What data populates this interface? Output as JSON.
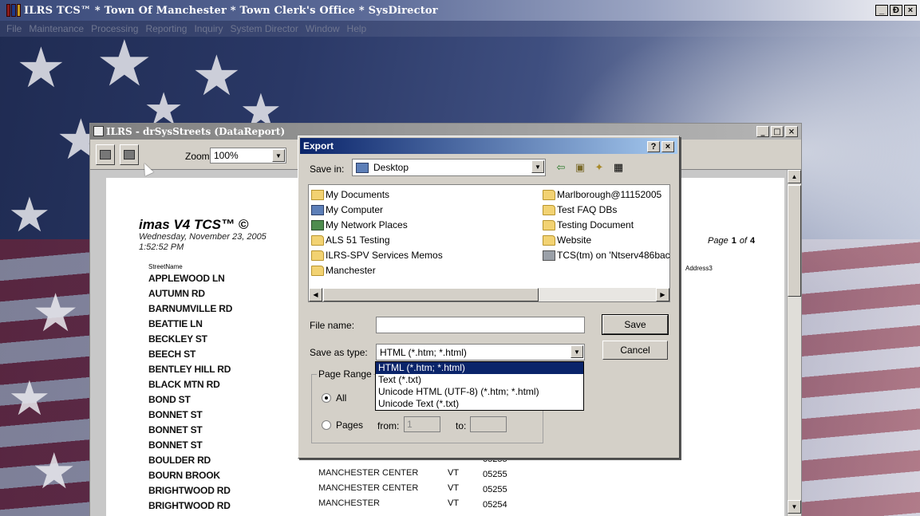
{
  "app": {
    "title": "ILRS TCS™ * Town Of Manchester * Town Clerk's Office * SysDirector",
    "controls": [
      "_",
      "Ɖ",
      "×"
    ],
    "menu": [
      "File",
      "Maintenance",
      "Processing",
      "Reporting",
      "Inquiry",
      "System Director",
      "Window",
      "Help"
    ]
  },
  "report_window": {
    "title": "ILRS - drSysStreets (DataReport)",
    "zoom_label": "Zoom",
    "zoom_value": "100%",
    "report_title": "imas V4 TCS™ ©",
    "report_date": "Wednesday, November 23, 2005",
    "report_time": "1:52:52 PM",
    "page_label": "Page",
    "page_current": "1",
    "page_of": "of",
    "page_total": "4",
    "col_street": "StreetName",
    "col_addr3": "Address3",
    "streets": [
      "APPLEWOOD LN",
      "AUTUMN RD",
      "BARNUMVILLE RD",
      "BEATTIE LN",
      "BECKLEY ST",
      "BEECH ST",
      "BENTLEY HILL RD",
      "BLACK MTN RD",
      "BOND ST",
      "BONNET ST",
      "BONNET ST",
      "BONNET ST",
      "BOULDER RD",
      "BOURN BROOK",
      "BRIGHTWOOD RD",
      "BRIGHTWOOD RD"
    ],
    "visible_rows": [
      {
        "city": "MANCHESTER CENTER",
        "state": "VT",
        "zip": "05255"
      },
      {
        "city": "MANCHESTER CENTER",
        "state": "VT",
        "zip": "05255"
      },
      {
        "city": "MANCHESTER CENTER",
        "state": "VT",
        "zip": "05255"
      },
      {
        "city": "MANCHESTER",
        "state": "VT",
        "zip": "05254"
      }
    ]
  },
  "export_dialog": {
    "title": "Export",
    "help_btn": "?",
    "close_btn": "×",
    "save_in_label": "Save in:",
    "save_in_value": "Desktop",
    "items_left": [
      {
        "label": "My Documents",
        "icon": "my-documents-icon"
      },
      {
        "label": "My Computer",
        "icon": "my-computer-icon"
      },
      {
        "label": "My Network Places",
        "icon": "network-places-icon"
      },
      {
        "label": "ALS 51 Testing",
        "icon": "folder-icon"
      },
      {
        "label": "ILRS-SPV Services Memos",
        "icon": "folder-icon"
      },
      {
        "label": "Manchester",
        "icon": "folder-icon"
      }
    ],
    "items_right": [
      {
        "label": "Marlborough@11152005",
        "icon": "folder-icon"
      },
      {
        "label": "Test FAQ DBs",
        "icon": "folder-icon"
      },
      {
        "label": "Testing Document",
        "icon": "folder-icon"
      },
      {
        "label": "Website",
        "icon": "folder-icon"
      },
      {
        "label": "TCS(tm) on 'Ntserv486bac",
        "icon": "network-drive-icon"
      }
    ],
    "file_name_label": "File name:",
    "file_name_value": "",
    "save_as_type_label": "Save as type:",
    "save_as_type_value": "HTML (*.htm; *.html)",
    "save_button": "Save",
    "cancel_button": "Cancel",
    "page_range_label": "Page Range",
    "all_label": "All",
    "pages_label": "Pages",
    "from_label": "from:",
    "from_value": "1",
    "to_label": "to:",
    "to_value": "",
    "type_options": [
      "HTML (*.htm; *.html)",
      "Text (*.txt)",
      "Unicode HTML (UTF-8) (*.htm; *.html)",
      "Unicode Text (*.txt)"
    ],
    "selected_option_index": 0
  }
}
